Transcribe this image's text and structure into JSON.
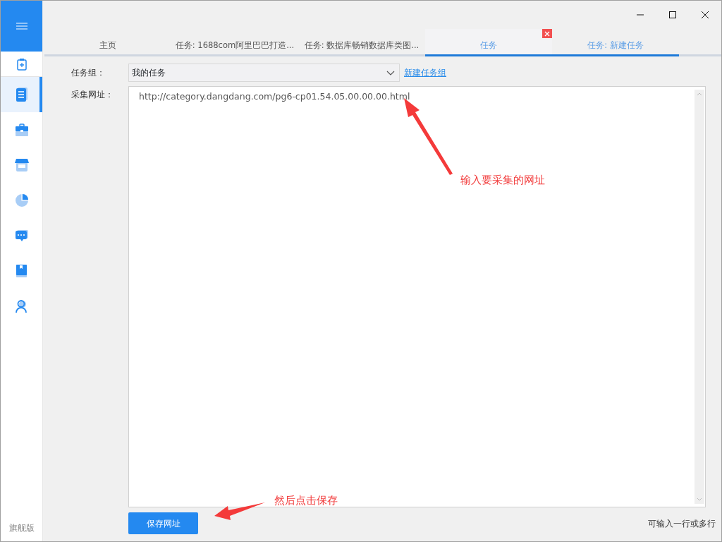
{
  "sidebar": {
    "items": [
      {
        "selected": false
      },
      {
        "selected": true
      },
      {
        "selected": false
      },
      {
        "selected": false
      },
      {
        "selected": false
      },
      {
        "selected": false
      },
      {
        "selected": false
      },
      {
        "selected": false
      }
    ],
    "edition": "旗舰版"
  },
  "tabs": [
    {
      "label": "主页",
      "selected": false,
      "closable": false
    },
    {
      "label": "任务: 1688com阿里巴巴打造...",
      "selected": false,
      "closable": false
    },
    {
      "label": "任务: 数据库畅销数据库类图...",
      "selected": false,
      "closable": false
    },
    {
      "label": "任务",
      "selected": true,
      "closable": true
    },
    {
      "label": "任务: 新建任务",
      "selected": true,
      "closable": false
    }
  ],
  "form": {
    "group_label": "任务组：",
    "group_value": "我的任务",
    "new_group_link": "新建任务组",
    "url_label": "采集网址：",
    "url_value": "http://category.dangdang.com/pg6-cp01.54.05.00.00.00.html",
    "save_button": "保存网址",
    "hint": "可输入一行或多行"
  },
  "annotations": [
    {
      "text": "输入要采集的网址"
    },
    {
      "text": "然后点击保存"
    }
  ]
}
